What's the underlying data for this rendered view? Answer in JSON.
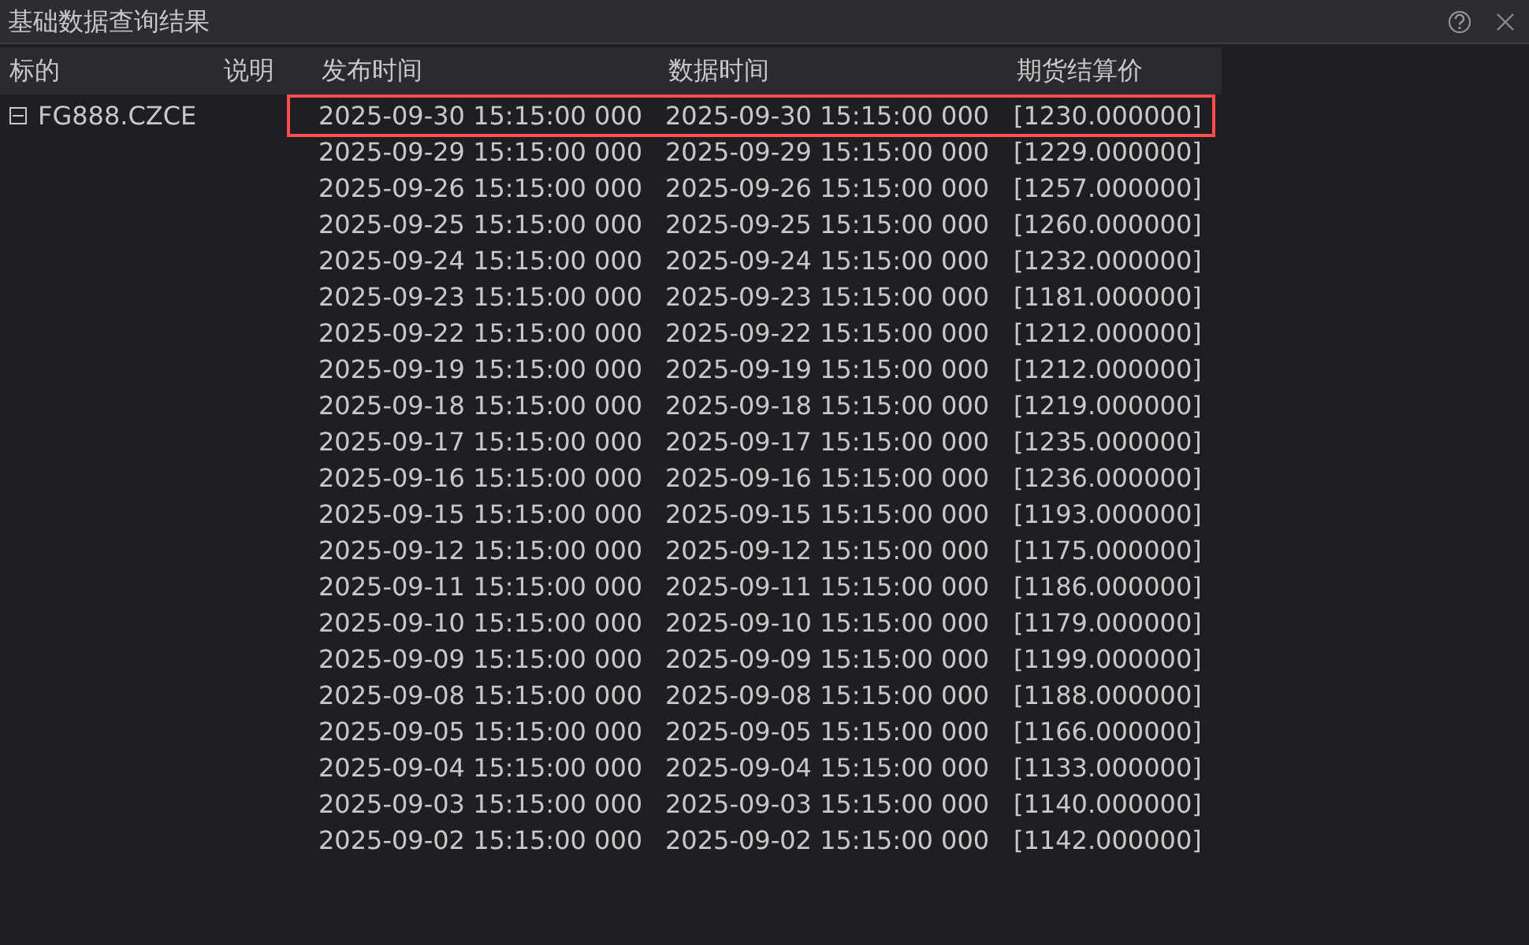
{
  "window": {
    "title": "基础数据查询结果"
  },
  "table": {
    "columns": [
      "标的",
      "说明",
      "发布时间",
      "数据时间",
      "期货结算价"
    ],
    "node": {
      "label": "FG888.CZCE",
      "expanded": true,
      "rows": [
        {
          "publish_time": "2025-09-30 15:15:00 000",
          "data_time": "2025-09-30 15:15:00 000",
          "price": "[1230.000000]",
          "selected": true
        },
        {
          "publish_time": "2025-09-29 15:15:00 000",
          "data_time": "2025-09-29 15:15:00 000",
          "price": "[1229.000000]",
          "selected": false
        },
        {
          "publish_time": "2025-09-26 15:15:00 000",
          "data_time": "2025-09-26 15:15:00 000",
          "price": "[1257.000000]",
          "selected": false
        },
        {
          "publish_time": "2025-09-25 15:15:00 000",
          "data_time": "2025-09-25 15:15:00 000",
          "price": "[1260.000000]",
          "selected": false
        },
        {
          "publish_time": "2025-09-24 15:15:00 000",
          "data_time": "2025-09-24 15:15:00 000",
          "price": "[1232.000000]",
          "selected": false
        },
        {
          "publish_time": "2025-09-23 15:15:00 000",
          "data_time": "2025-09-23 15:15:00 000",
          "price": "[1181.000000]",
          "selected": false
        },
        {
          "publish_time": "2025-09-22 15:15:00 000",
          "data_time": "2025-09-22 15:15:00 000",
          "price": "[1212.000000]",
          "selected": false
        },
        {
          "publish_time": "2025-09-19 15:15:00 000",
          "data_time": "2025-09-19 15:15:00 000",
          "price": "[1212.000000]",
          "selected": false
        },
        {
          "publish_time": "2025-09-18 15:15:00 000",
          "data_time": "2025-09-18 15:15:00 000",
          "price": "[1219.000000]",
          "selected": false
        },
        {
          "publish_time": "2025-09-17 15:15:00 000",
          "data_time": "2025-09-17 15:15:00 000",
          "price": "[1235.000000]",
          "selected": false
        },
        {
          "publish_time": "2025-09-16 15:15:00 000",
          "data_time": "2025-09-16 15:15:00 000",
          "price": "[1236.000000]",
          "selected": false
        },
        {
          "publish_time": "2025-09-15 15:15:00 000",
          "data_time": "2025-09-15 15:15:00 000",
          "price": "[1193.000000]",
          "selected": false
        },
        {
          "publish_time": "2025-09-12 15:15:00 000",
          "data_time": "2025-09-12 15:15:00 000",
          "price": "[1175.000000]",
          "selected": false
        },
        {
          "publish_time": "2025-09-11 15:15:00 000",
          "data_time": "2025-09-11 15:15:00 000",
          "price": "[1186.000000]",
          "selected": false
        },
        {
          "publish_time": "2025-09-10 15:15:00 000",
          "data_time": "2025-09-10 15:15:00 000",
          "price": "[1179.000000]",
          "selected": false
        },
        {
          "publish_time": "2025-09-09 15:15:00 000",
          "data_time": "2025-09-09 15:15:00 000",
          "price": "[1199.000000]",
          "selected": false
        },
        {
          "publish_time": "2025-09-08 15:15:00 000",
          "data_time": "2025-09-08 15:15:00 000",
          "price": "[1188.000000]",
          "selected": false
        },
        {
          "publish_time": "2025-09-05 15:15:00 000",
          "data_time": "2025-09-05 15:15:00 000",
          "price": "[1166.000000]",
          "selected": false
        },
        {
          "publish_time": "2025-09-04 15:15:00 000",
          "data_time": "2025-09-04 15:15:00 000",
          "price": "[1133.000000]",
          "selected": false
        },
        {
          "publish_time": "2025-09-03 15:15:00 000",
          "data_time": "2025-09-03 15:15:00 000",
          "price": "[1140.000000]",
          "selected": false
        },
        {
          "publish_time": "2025-09-02 15:15:00 000",
          "data_time": "2025-09-02 15:15:00 000",
          "price": "[1142.000000]",
          "selected": false
        }
      ]
    }
  }
}
